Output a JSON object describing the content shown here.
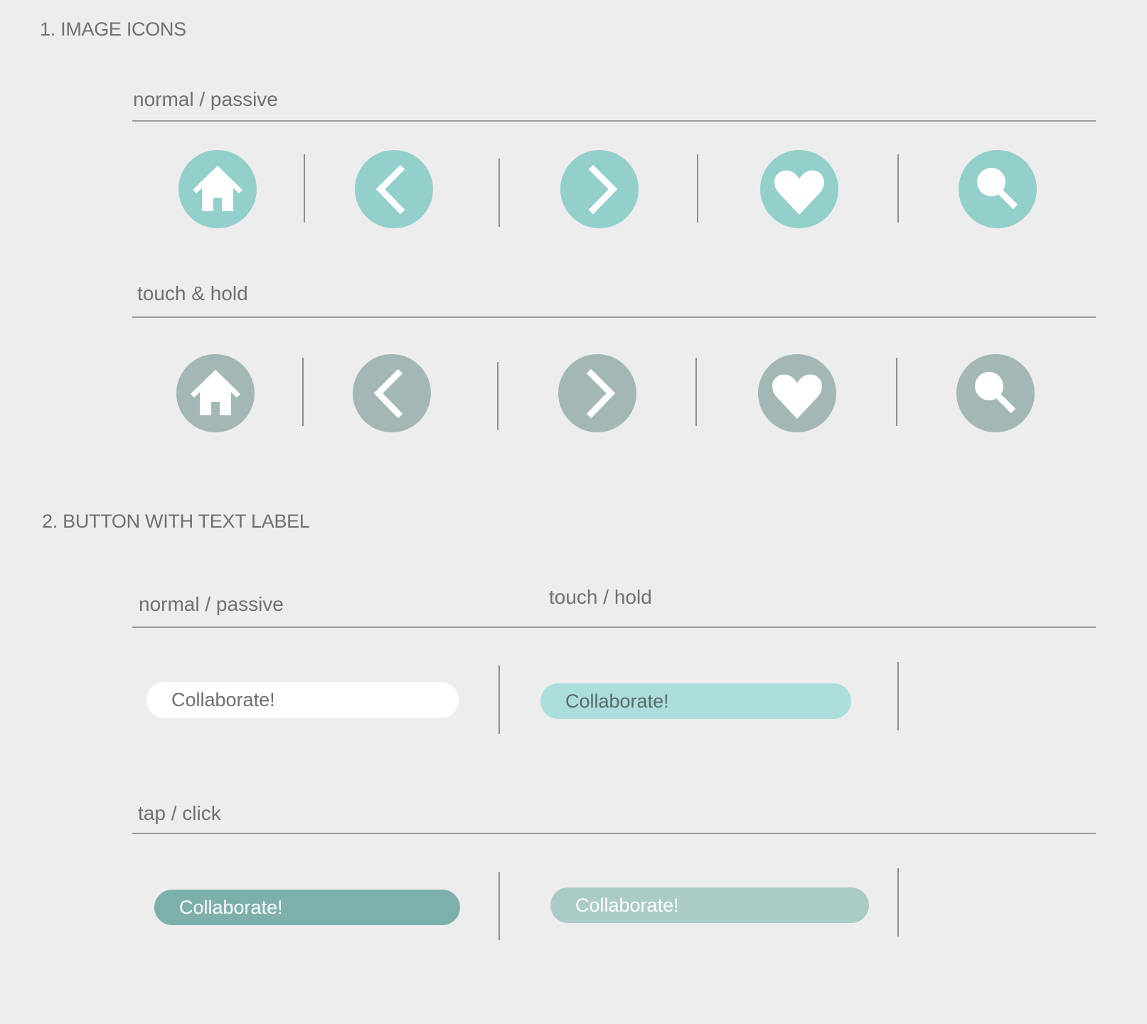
{
  "sections": {
    "image_icons": {
      "title": "1. IMAGE ICONS",
      "normal_label": "normal / passive",
      "hold_label": "touch & hold",
      "icons": [
        "home-icon",
        "chevron-left-icon",
        "chevron-right-icon",
        "heart-icon",
        "search-icon"
      ]
    },
    "text_buttons": {
      "title": "2. BUTTON WITH TEXT LABEL",
      "normal_label": "normal / passive",
      "hold_label": "touch / hold",
      "tap_label": "tap / click",
      "button_text": "Collaborate!"
    }
  },
  "colors": {
    "background": "#ededed",
    "icon_normal": "#93cfcb",
    "icon_hold": "#a3b8b4",
    "button_normal_bg": "#ffffff",
    "button_hold_bg": "#acdedd",
    "button_tap_bg": "#7eb0ab",
    "button_tap_alt_bg": "#aacbc6",
    "label_text": "#707070",
    "rule": "#9a9a9a"
  }
}
